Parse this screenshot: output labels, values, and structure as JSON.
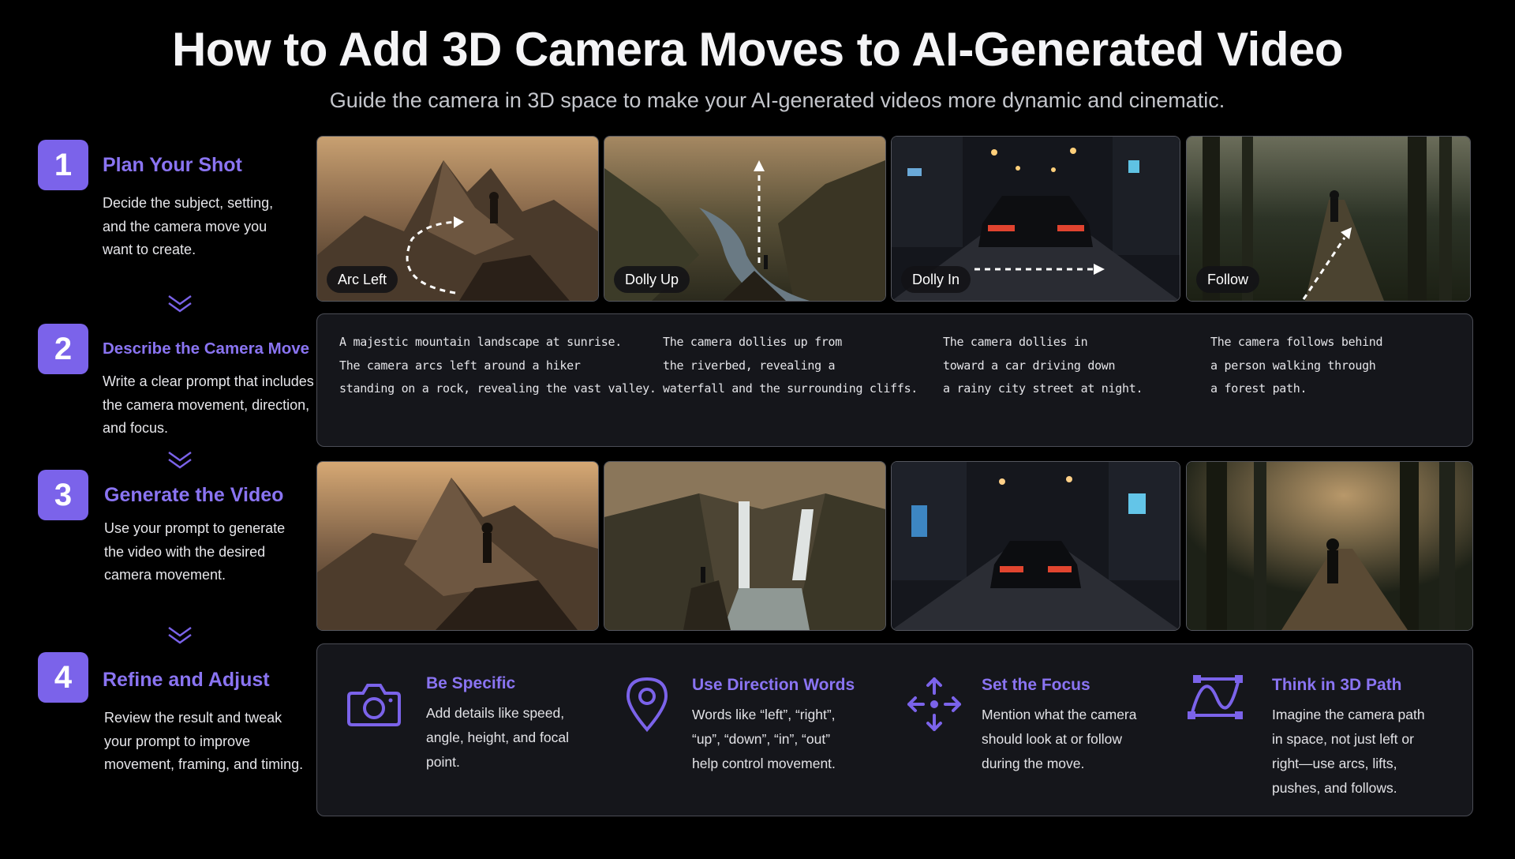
{
  "header": {
    "title": "How to Add 3D Camera Moves to AI-Generated Video",
    "subtitle": "Guide the camera in 3D space to make your AI-generated videos more dynamic and cinematic."
  },
  "colors": {
    "accent": "#7b63ea",
    "accent_text": "#8a74f2",
    "panel": "#15161b",
    "background": "#000000"
  },
  "steps": [
    {
      "number": "1",
      "title": "Plan Your Shot",
      "desc": "Decide the subject, setting, and the camera move you want to create."
    },
    {
      "number": "2",
      "title": "Describe the Camera Move",
      "desc": "Write a clear prompt that includes the camera movement, direction, and focus."
    },
    {
      "number": "3",
      "title": "Generate the Video",
      "desc": "Use your prompt to generate the video with the desired camera movement."
    },
    {
      "number": "4",
      "title": "Refine and Adjust",
      "desc": "Review the result and tweak your prompt to improve movement, framing, and timing."
    }
  ],
  "moves": [
    {
      "label": "Arc Left",
      "prompt": "A majestic mountain landscape at sunrise.\nThe camera arcs left around a hiker\nstanding on a rock, revealing the vast valley."
    },
    {
      "label": "Dolly Up",
      "prompt": "The camera dollies up from\nthe riverbed, revealing a\nwaterfall and the surrounding cliffs."
    },
    {
      "label": "Dolly In",
      "prompt": "The camera dollies in\ntoward a car driving down\na rainy city street at night."
    },
    {
      "label": "Follow",
      "prompt": "The camera follows behind\na person walking through\na forest path."
    }
  ],
  "tips": [
    {
      "icon": "camera-icon",
      "title": "Be Specific",
      "body": "Add details like speed, angle, height, and focal point."
    },
    {
      "icon": "location-pin-icon",
      "title": "Use Direction Words",
      "body": "Words like “left”, “right”, “up”, “down”, “in”, “out” help control movement."
    },
    {
      "icon": "move-arrows-icon",
      "title": "Set the Focus",
      "body": "Mention what the camera should look at or follow during the move."
    },
    {
      "icon": "bezier-path-icon",
      "title": "Think in 3D Path",
      "body": "Imagine the camera path in space, not just left or right—use arcs, lifts, pushes, and follows."
    }
  ]
}
